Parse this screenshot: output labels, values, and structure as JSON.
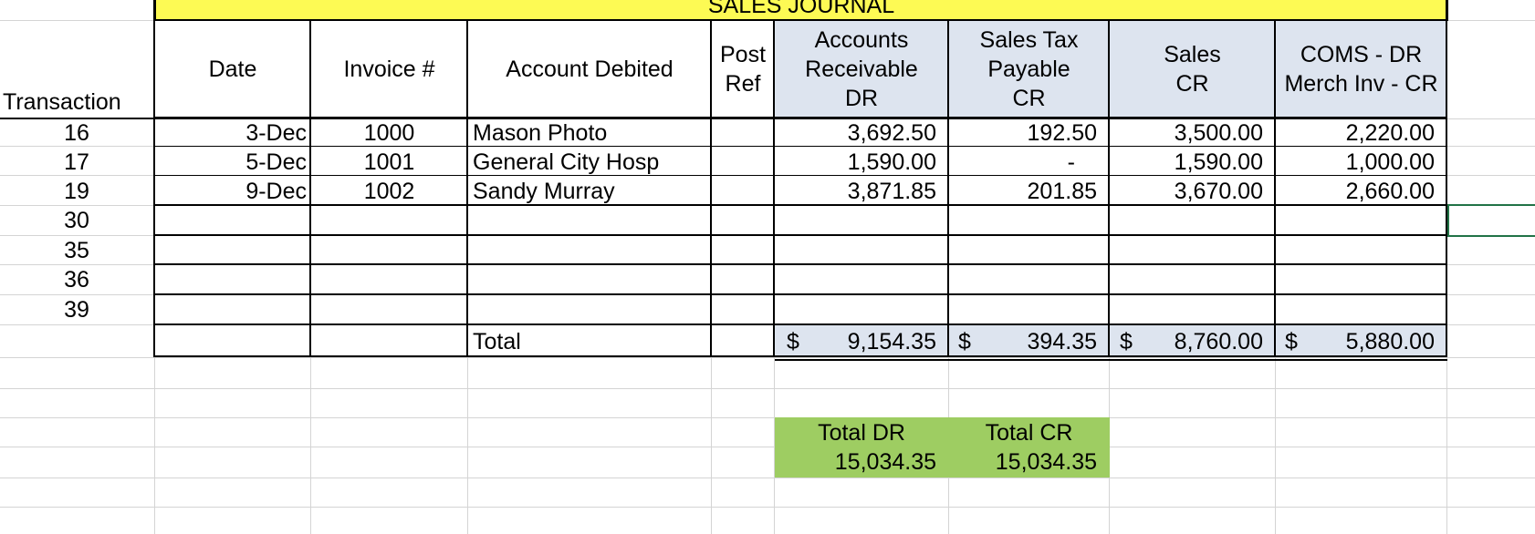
{
  "journal_title": "SALES JOURNAL",
  "headers": {
    "transaction": "Transaction",
    "date": "Date",
    "invoice": "Invoice #",
    "account": "Account Debited",
    "post_ref": [
      "Post",
      "Ref"
    ],
    "ar": [
      "Accounts",
      "Receivable",
      "DR"
    ],
    "tax": [
      "Sales Tax",
      "Payable",
      "CR"
    ],
    "sales": [
      "Sales",
      "CR"
    ],
    "coms": [
      "COMS - DR",
      "Merch Inv - CR"
    ]
  },
  "rows": [
    {
      "transaction": "16",
      "date": "3-Dec",
      "invoice": "1000",
      "account": "Mason Photo",
      "post_ref": "",
      "ar": "3,692.50",
      "tax": "192.50",
      "sales": "3,500.00",
      "coms": "2,220.00"
    },
    {
      "transaction": "17",
      "date": "5-Dec",
      "invoice": "1001",
      "account": "General City Hosp",
      "post_ref": "",
      "ar": "1,590.00",
      "tax": "-",
      "sales": "1,590.00",
      "coms": "1,000.00"
    },
    {
      "transaction": "19",
      "date": "9-Dec",
      "invoice": "1002",
      "account": "Sandy Murray",
      "post_ref": "",
      "ar": "3,871.85",
      "tax": "201.85",
      "sales": "3,670.00",
      "coms": "2,660.00"
    },
    {
      "transaction": "30",
      "date": "",
      "invoice": "",
      "account": "",
      "post_ref": "",
      "ar": "",
      "tax": "",
      "sales": "",
      "coms": ""
    },
    {
      "transaction": "35",
      "date": "",
      "invoice": "",
      "account": "",
      "post_ref": "",
      "ar": "",
      "tax": "",
      "sales": "",
      "coms": ""
    },
    {
      "transaction": "36",
      "date": "",
      "invoice": "",
      "account": "",
      "post_ref": "",
      "ar": "",
      "tax": "",
      "sales": "",
      "coms": ""
    },
    {
      "transaction": "39",
      "date": "",
      "invoice": "",
      "account": "",
      "post_ref": "",
      "ar": "",
      "tax": "",
      "sales": "",
      "coms": ""
    }
  ],
  "total_row": {
    "label": "Total",
    "currency": "$",
    "ar": "9,154.35",
    "tax": "394.35",
    "sales": "8,760.00",
    "coms": "5,880.00"
  },
  "summary": {
    "total_dr_label": "Total DR",
    "total_dr_value": "15,034.35",
    "total_cr_label": "Total CR",
    "total_cr_value": "15,034.35"
  },
  "colors": {
    "title_bg": "#fdfa54",
    "header_bg": "#dde4ef",
    "summary_bg": "#9ecd62",
    "selection": "#217346",
    "gridline": "#d4d4d4"
  }
}
